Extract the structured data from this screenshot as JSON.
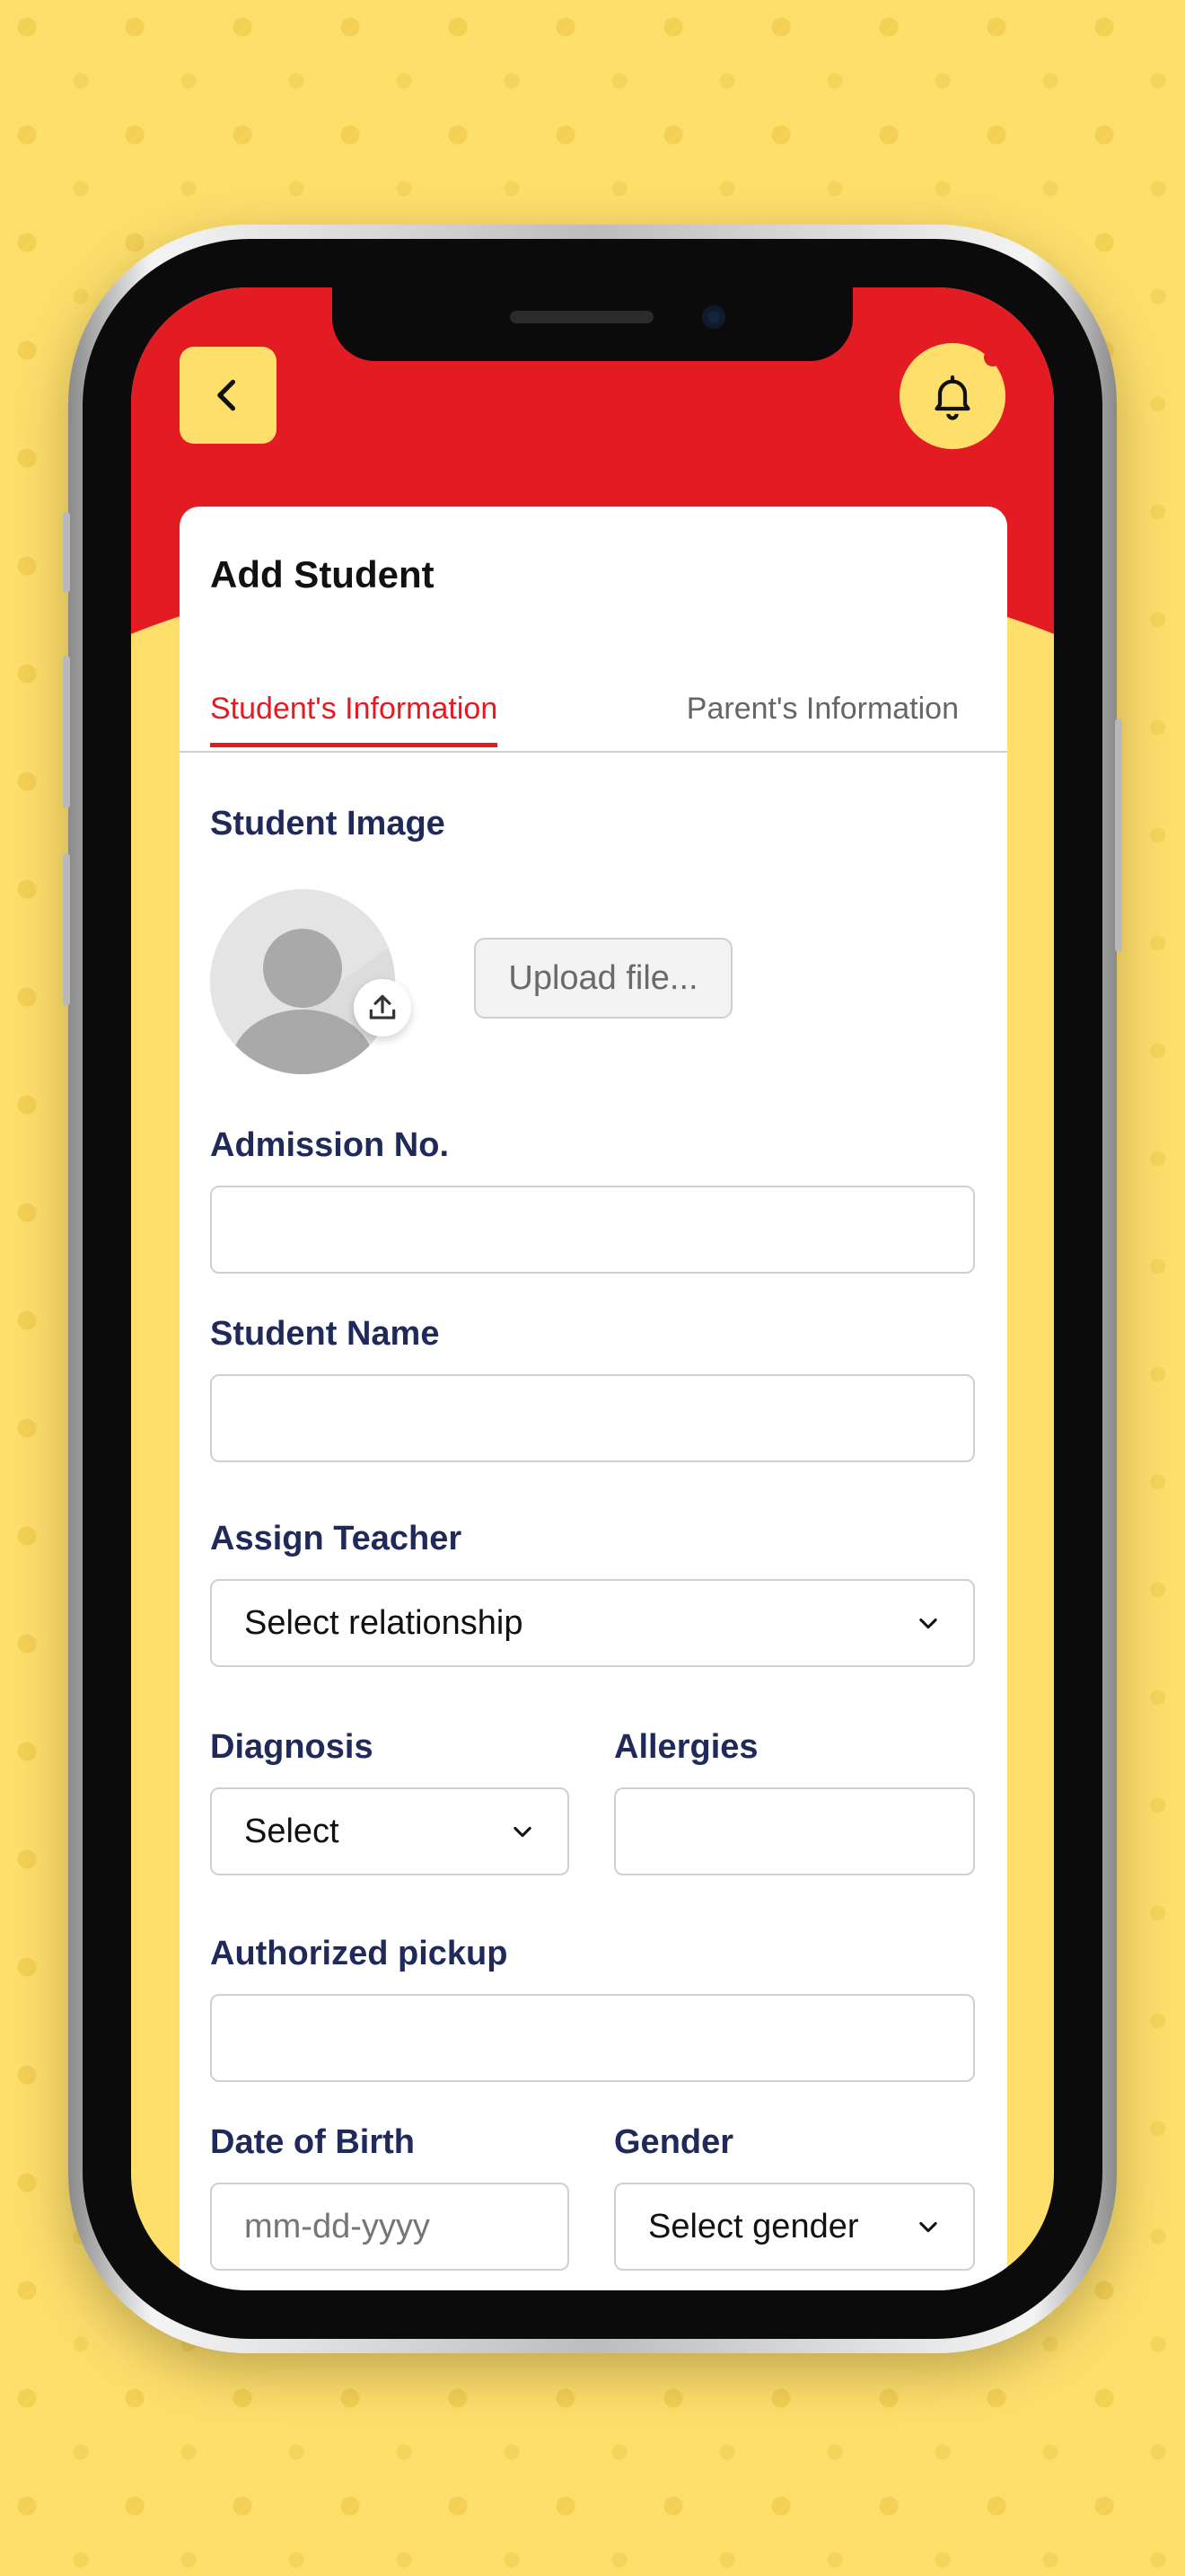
{
  "header": {
    "back_icon": "chevron-left-icon",
    "notification_icon": "bell-icon",
    "has_unread_notification": true
  },
  "page": {
    "title": "Add Student",
    "tabs": [
      {
        "label": "Student's Information",
        "active": true
      },
      {
        "label": "Parent's Information",
        "active": false
      }
    ]
  },
  "form": {
    "student_image": {
      "label": "Student Image",
      "upload_button": "Upload file..."
    },
    "admission_no": {
      "label": "Admission No.",
      "value": ""
    },
    "student_name": {
      "label": "Student Name",
      "value": ""
    },
    "assign_teacher": {
      "label": "Assign Teacher",
      "selected": "Select relationship"
    },
    "diagnosis": {
      "label": "Diagnosis",
      "selected": "Select"
    },
    "allergies": {
      "label": "Allergies",
      "value": ""
    },
    "authorized_pickup": {
      "label": "Authorized pickup",
      "value": ""
    },
    "date_of_birth": {
      "label": "Date of Birth",
      "placeholder": "mm-dd-yyyy"
    },
    "gender": {
      "label": "Gender",
      "selected": "Select gender"
    }
  },
  "colors": {
    "background": "#FEDF6C",
    "brand_red": "#E31B23",
    "label_navy": "#1F2A5A"
  }
}
